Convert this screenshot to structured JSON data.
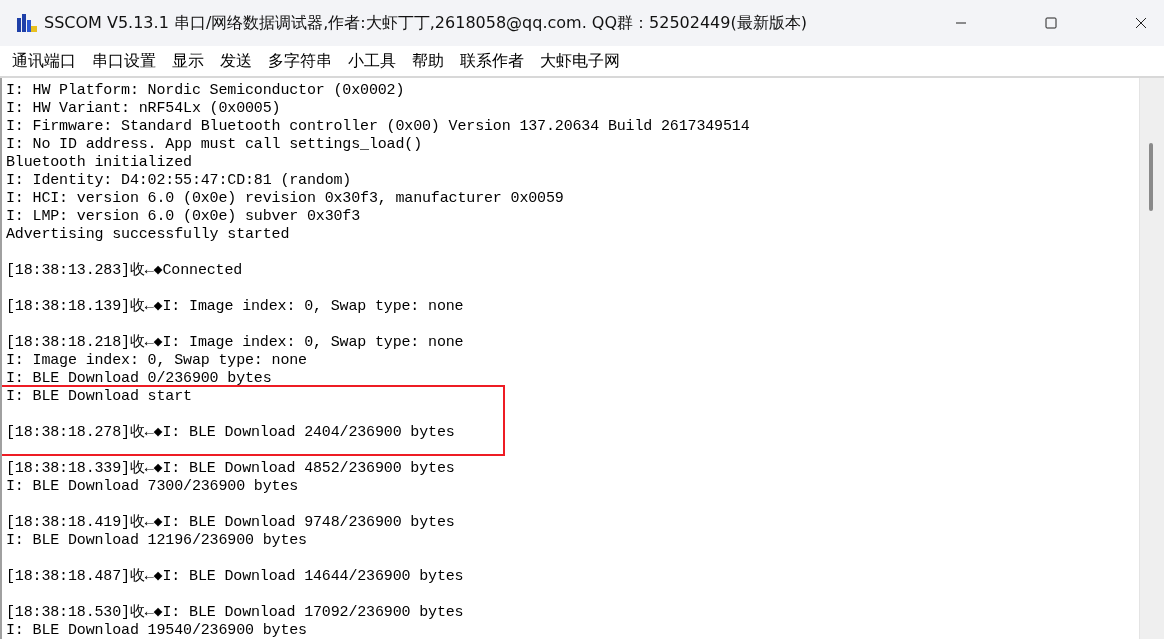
{
  "window": {
    "title": "SSCOM V5.13.1 串口/网络数据调试器,作者:大虾丁丁,2618058@qq.com. QQ群：52502449(最新版本)",
    "controls": [
      {
        "kind": "minimize"
      },
      {
        "kind": "maximize"
      },
      {
        "kind": "close"
      }
    ]
  },
  "menu": [
    "通讯端口",
    "串口设置",
    "显示",
    "发送",
    "多字符串",
    "小工具",
    "帮助",
    "联系作者",
    "大虾电子网"
  ],
  "log": {
    "blocks": [
      {
        "lines": [
          "I: HW Platform: Nordic Semiconductor (0x0002)",
          "I: HW Variant: nRF54Lx (0x0005)",
          "I: Firmware: Standard Bluetooth controller (0x00) Version 137.20634 Build 2617349514",
          "I: No ID address. App must call settings_load()",
          "Bluetooth initialized",
          "I: Identity: D4:02:55:47:CD:81 (random)",
          "I: HCI: version 6.0 (0x0e) revision 0x30f3, manufacturer 0x0059",
          "I: LMP: version 6.0 (0x0e) subver 0x30f3",
          "Advertising successfully started"
        ]
      },
      {
        "lines": [
          "[18:38:13.283]收←◆Connected"
        ]
      },
      {
        "lines": [
          "[18:38:18.139]收←◆I: Image index: 0, Swap type: none"
        ]
      },
      {
        "lines": [
          "[18:38:18.218]收←◆I: Image index: 0, Swap type: none",
          "I: Image index: 0, Swap type: none",
          "I: BLE Download 0/236900 bytes",
          "I: BLE Download start"
        ]
      },
      {
        "lines": [
          "[18:38:18.278]收←◆I: BLE Download 2404/236900 bytes"
        ]
      },
      {
        "lines": [
          "[18:38:18.339]收←◆I: BLE Download 4852/236900 bytes",
          "I: BLE Download 7300/236900 bytes"
        ]
      },
      {
        "lines": [
          "[18:38:18.419]收←◆I: BLE Download 9748/236900 bytes",
          "I: BLE Download 12196/236900 bytes"
        ]
      },
      {
        "lines": [
          "[18:38:18.487]收←◆I: BLE Download 14644/236900 bytes"
        ]
      },
      {
        "lines": [
          "[18:38:18.530]收←◆I: BLE Download 17092/236900 bytes",
          "I: BLE Download 19540/236900 bytes"
        ]
      }
    ]
  },
  "annotations": [
    {
      "kind": "rectangle",
      "color": "#ee1c24"
    }
  ]
}
